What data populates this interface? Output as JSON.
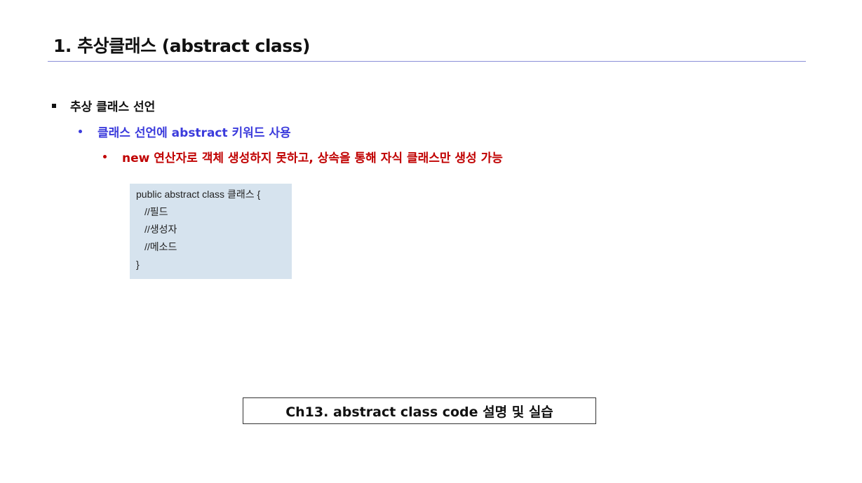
{
  "slide": {
    "title": "1. 추상클래스 (abstract class)",
    "bullets": {
      "level1": "추상 클래스 선언",
      "level2": "클래스 선언에 abstract 키워드 사용",
      "level3": "new 연산자로 객체 생성하지 못하고, 상속을 통해 자식 클래스만 생성 가능"
    },
    "code": {
      "line1": "public abstract class 클래스 {",
      "line2": "//필드",
      "line3": "//생성자",
      "line4": "//메소드",
      "line5": "}"
    },
    "footer_label": "Ch13. abstract class code 설명 및 실습"
  },
  "colors": {
    "title_rule": "#8a8fd8",
    "level2_text": "#3b3bdc",
    "level3_text": "#c00000",
    "code_background": "#d6e3ee"
  }
}
